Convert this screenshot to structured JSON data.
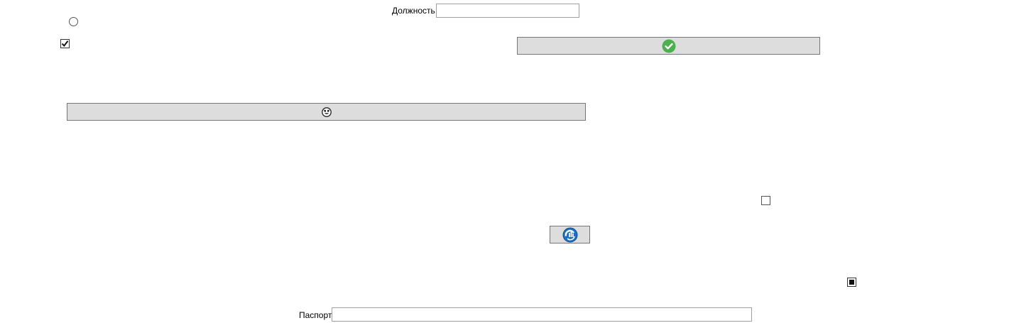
{
  "form": {
    "position_label": "Должность",
    "position_value": "",
    "passport_label": "Паспорт",
    "passport_value": ""
  },
  "controls": {
    "radio_1": {
      "checked": false
    },
    "checkbox_1": {
      "checked": true
    },
    "checkbox_2": {
      "checked": false
    },
    "checkbox_3": {
      "state": "indeterminate"
    }
  },
  "buttons": {
    "confirm_button": {
      "icon": "green-check-circle-icon"
    },
    "face_button": {
      "icon": "smiley-face-icon"
    },
    "refresh_button": {
      "icon": "blue-refresh-icon"
    }
  },
  "colors": {
    "button_bg": "#dddddd",
    "button_border": "#777777",
    "check_green": "#4caf50",
    "refresh_blue": "#1e6fc2"
  }
}
